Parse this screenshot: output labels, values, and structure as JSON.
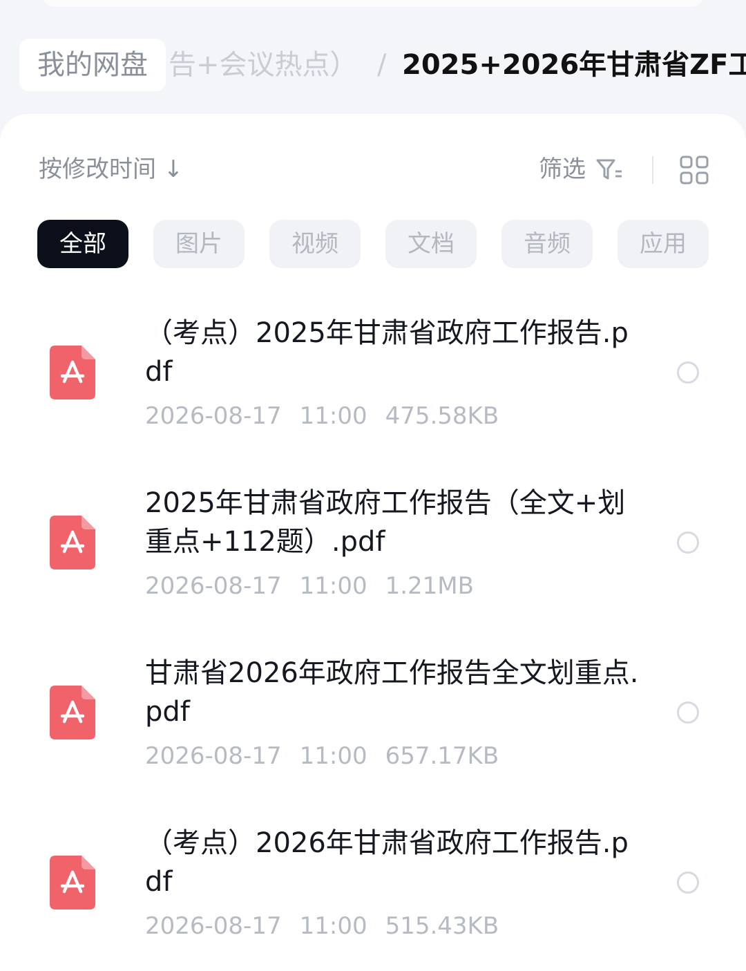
{
  "breadcrumb": {
    "root": "我的网盘",
    "middle": "告+会议热点）",
    "separator": "/",
    "current": "2025+2026年甘肃省ZF工"
  },
  "toolbar": {
    "sort_label": "按修改时间 ↓",
    "filter_label": "筛选",
    "filter_icon": "filter-icon",
    "view_icon": "grid-view-icon"
  },
  "tabs": [
    {
      "label": "全部",
      "active": true
    },
    {
      "label": "图片",
      "active": false
    },
    {
      "label": "视频",
      "active": false
    },
    {
      "label": "文档",
      "active": false
    },
    {
      "label": "音频",
      "active": false
    },
    {
      "label": "应用",
      "active": false
    }
  ],
  "files": [
    {
      "name": "（考点）2025年甘肃省政府工作报告.pdf",
      "date": "2026-08-17",
      "time": "11:00",
      "size": "475.58KB",
      "icon": "pdf-icon"
    },
    {
      "name": "2025年甘肃省政府工作报告（全文+划重点+112题）.pdf",
      "date": "2026-08-17",
      "time": "11:00",
      "size": "1.21MB",
      "icon": "pdf-icon"
    },
    {
      "name": "甘肃省2026年政府工作报告全文划重点.pdf",
      "date": "2026-08-17",
      "time": "11:00",
      "size": "657.17KB",
      "icon": "pdf-icon"
    },
    {
      "name": "（考点）2026年甘肃省政府工作报告.pdf",
      "date": "2026-08-17",
      "time": "11:00",
      "size": "515.43KB",
      "icon": "pdf-icon"
    }
  ],
  "colors": {
    "pdf_icon": "#f0636b",
    "active_tab_bg": "#0b0f1a",
    "page_bg": "#f4f5f8"
  }
}
